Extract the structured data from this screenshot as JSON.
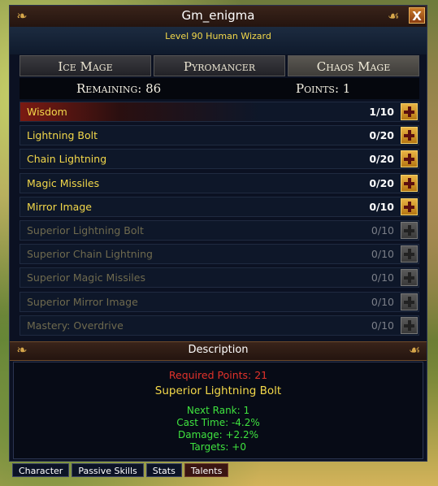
{
  "window": {
    "title": "Gm_enigma",
    "subtitle": "Level 90 Human Wizard",
    "close_label": "X"
  },
  "class_tabs": [
    {
      "label": "Ice Mage",
      "active": false
    },
    {
      "label": "Pyromancer",
      "active": false
    },
    {
      "label": "Chaos Mage",
      "active": true
    }
  ],
  "points_bar": {
    "remaining": "Remaining: 86",
    "points": "Points: 1"
  },
  "talents": [
    {
      "name": "Wisdom",
      "rank": "1/10",
      "locked": false,
      "selected": true
    },
    {
      "name": "Lightning Bolt",
      "rank": "0/20",
      "locked": false
    },
    {
      "name": "Chain Lightning",
      "rank": "0/20",
      "locked": false
    },
    {
      "name": "Magic Missiles",
      "rank": "0/20",
      "locked": false
    },
    {
      "name": "Mirror Image",
      "rank": "0/10",
      "locked": false
    },
    {
      "name": "Superior Lightning Bolt",
      "rank": "0/10",
      "locked": true
    },
    {
      "name": "Superior Chain Lightning",
      "rank": "0/10",
      "locked": true
    },
    {
      "name": "Superior Magic Missiles",
      "rank": "0/10",
      "locked": true
    },
    {
      "name": "Superior Mirror Image",
      "rank": "0/10",
      "locked": true
    },
    {
      "name": "Mastery: Overdrive",
      "rank": "0/10",
      "locked": true
    }
  ],
  "description": {
    "header": "Description",
    "required": "Required Points: 21",
    "skill_name": "Superior Lightning Bolt",
    "lines": [
      "Next Rank: 1",
      "Cast Time: -4.2%",
      "Damage: +2.2%",
      "Targets: +0"
    ]
  },
  "bottom_tabs": [
    {
      "label": "Character",
      "active": false
    },
    {
      "label": "Passive Skills",
      "active": false
    },
    {
      "label": "Stats",
      "active": false
    },
    {
      "label": "Talents",
      "active": true
    }
  ],
  "colors": {
    "gold_text": "#f3d84a",
    "required_red": "#e2322a",
    "stat_green": "#3fe33f",
    "plus_gold": "#e9b444"
  }
}
